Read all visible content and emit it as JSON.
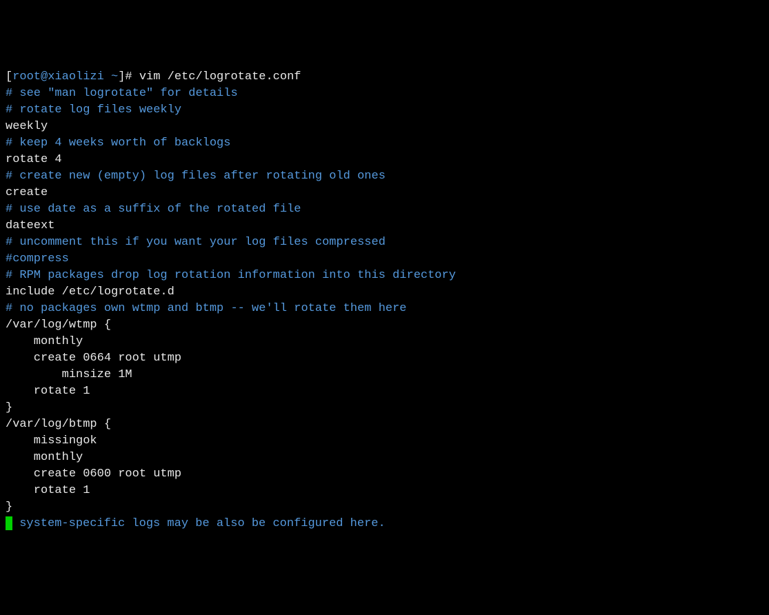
{
  "terminal": {
    "prompt_open": "[",
    "prompt_user": "root@xiaolizi ~",
    "prompt_close": "]# ",
    "command": "vim /etc/logrotate.conf",
    "lines": [
      {
        "text": "",
        "class": "white"
      },
      {
        "text": "# see \"man logrotate\" for details",
        "class": "cyan"
      },
      {
        "text": "# rotate log files weekly",
        "class": "cyan"
      },
      {
        "text": "weekly",
        "class": "white"
      },
      {
        "text": "# keep 4 weeks worth of backlogs",
        "class": "cyan"
      },
      {
        "text": "rotate 4",
        "class": "white"
      },
      {
        "text": "# create new (empty) log files after rotating old ones",
        "class": "cyan"
      },
      {
        "text": "create",
        "class": "white"
      },
      {
        "text": "# use date as a suffix of the rotated file",
        "class": "cyan"
      },
      {
        "text": "dateext",
        "class": "white"
      },
      {
        "text": "# uncomment this if you want your log files compressed",
        "class": "cyan"
      },
      {
        "text": "#compress",
        "class": "cyan"
      },
      {
        "text": "# RPM packages drop log rotation information into this directory",
        "class": "cyan"
      },
      {
        "text": "include /etc/logrotate.d",
        "class": "white"
      },
      {
        "text": "",
        "class": "white"
      },
      {
        "text": "# no packages own wtmp and btmp -- we'll rotate them here",
        "class": "cyan"
      },
      {
        "text": "/var/log/wtmp {",
        "class": "white"
      },
      {
        "text": "    monthly",
        "class": "white"
      },
      {
        "text": "    create 0664 root utmp",
        "class": "white"
      },
      {
        "text": "        minsize 1M",
        "class": "white"
      },
      {
        "text": "    rotate 1",
        "class": "white"
      },
      {
        "text": "}",
        "class": "white"
      },
      {
        "text": "",
        "class": "white"
      },
      {
        "text": "/var/log/btmp {",
        "class": "white"
      },
      {
        "text": "    missingok",
        "class": "white"
      },
      {
        "text": "    monthly",
        "class": "white"
      },
      {
        "text": "    create 0600 root utmp",
        "class": "white"
      },
      {
        "text": "    rotate 1",
        "class": "white"
      },
      {
        "text": "}",
        "class": "white"
      },
      {
        "text": "",
        "class": "white"
      }
    ],
    "last_line_text": " system-specific logs may be also be configured here."
  }
}
